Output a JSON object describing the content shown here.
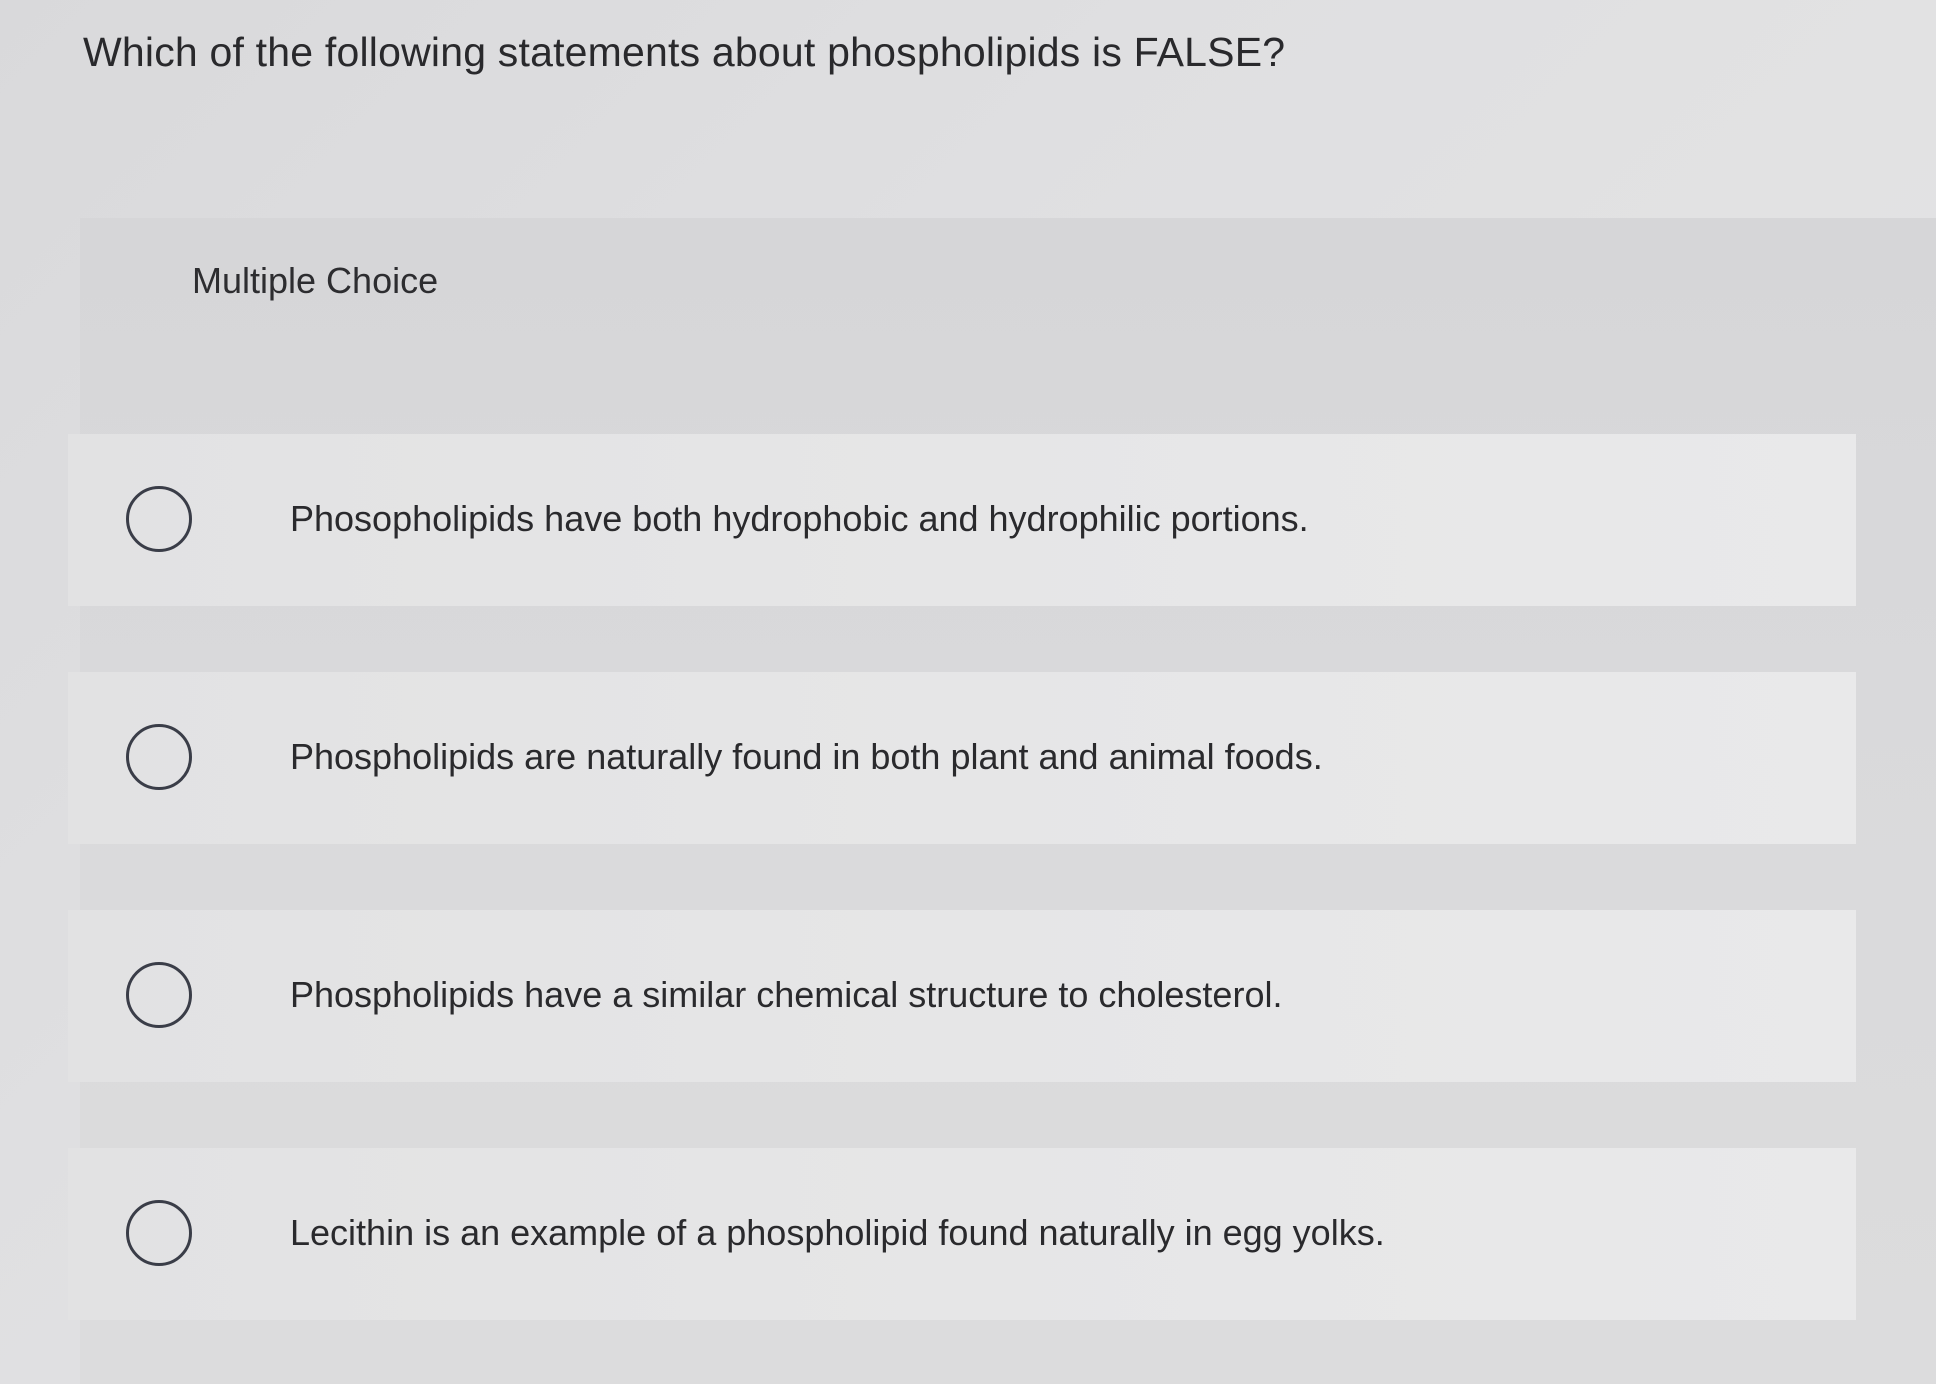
{
  "question": {
    "text": "Which of the following statements about phospholipids is FALSE?"
  },
  "panel": {
    "label": "Multiple Choice"
  },
  "options": [
    {
      "text": "Phosopholipids have both hydrophobic and hydrophilic portions."
    },
    {
      "text": "Phospholipids are naturally found in both plant and animal foods."
    },
    {
      "text": "Phospholipids have a similar chemical structure to cholesterol."
    },
    {
      "text": "Lecithin is an example of a phospholipid found naturally in egg yolks."
    }
  ]
}
